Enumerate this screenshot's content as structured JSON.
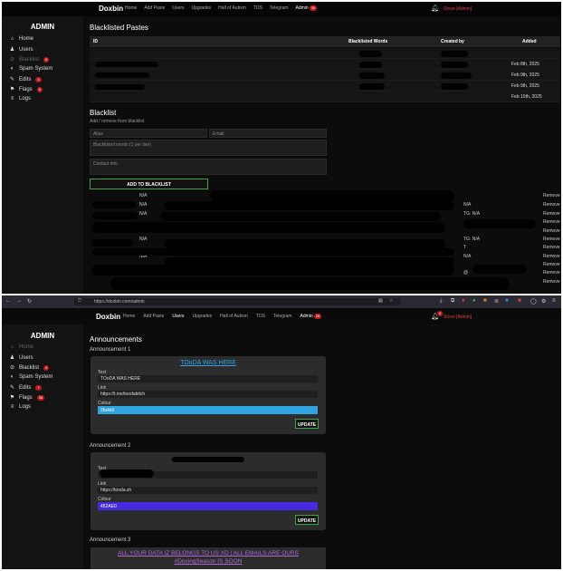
{
  "top": {
    "brand": "Doxbin",
    "nav": [
      "Home",
      "Add Paste",
      "Users",
      "Upgrades",
      "Hall of Autism",
      "TOS",
      "Telegram"
    ],
    "nav_admin": "Admin",
    "nav_admin_badge": "26",
    "user": "Stove [Admin]",
    "sidebar_title": "ADMIN",
    "sidebar": [
      {
        "label": "Home",
        "icon": "home-icon",
        "glyph": "⌂",
        "badge": ""
      },
      {
        "label": "Users",
        "icon": "user-icon",
        "glyph": "♟",
        "badge": ""
      },
      {
        "label": "Blacklist",
        "icon": "ban-icon",
        "glyph": "⊘",
        "badge": "6"
      },
      {
        "label": "Spam System",
        "icon": "toggle-icon",
        "glyph": "◐",
        "badge": ""
      },
      {
        "label": "Edits",
        "icon": "pencil-icon",
        "glyph": "✎",
        "badge": "4"
      },
      {
        "label": "Flags",
        "icon": "flag-icon",
        "glyph": "⚑",
        "badge": "6"
      },
      {
        "label": "Logs",
        "icon": "list-icon",
        "glyph": "≡",
        "badge": ""
      }
    ],
    "page_title": "Blacklisted Pastes",
    "table_headers": [
      "ID",
      "Blacklisted Words",
      "Created by",
      "Added"
    ],
    "rows_added": [
      "",
      "Feb 8th, 2025",
      "Feb 9th, 2025",
      "Feb 9th, 2025",
      "Feb 10th, 2025"
    ],
    "blacklist_title": "Blacklist",
    "blacklist_subtitle": "Add / remove from blacklist",
    "alias_placeholder": "Alias",
    "email_placeholder": "Email",
    "words_placeholder": "Blacklisted words (1 per line)",
    "contact_placeholder": "Contact info",
    "add_button": "ADD TO BLACKLIST",
    "bl_left": [
      "N/A",
      "N/A",
      "N/A",
      "",
      "",
      "N/A",
      "",
      "N/A",
      "",
      "",
      ""
    ],
    "bl_right": [
      "",
      "N/A",
      "TG: N/A",
      "",
      "",
      "TG: N/A",
      "T",
      "N/A",
      "",
      "@",
      ""
    ],
    "remove_label": "Remove"
  },
  "bottom": {
    "url": "https://doxbin.com/admin",
    "brand": "Doxbin",
    "nav": [
      "Home",
      "Add Paste",
      "Users",
      "Upgrades",
      "Hall of Autism",
      "TOS",
      "Telegram"
    ],
    "nav_admin": "Admin",
    "nav_admin_badge": "26",
    "bell_badge": "3",
    "user": "Stove [Admin]",
    "sidebar_title": "ADMIN",
    "sidebar": [
      {
        "label": "Home",
        "icon": "home-icon",
        "glyph": "⌂",
        "badge": ""
      },
      {
        "label": "Users",
        "icon": "user-icon",
        "glyph": "♟",
        "badge": ""
      },
      {
        "label": "Blacklist",
        "icon": "ban-icon",
        "glyph": "⊘",
        "badge": "4"
      },
      {
        "label": "Spam System",
        "icon": "toggle-icon",
        "glyph": "◐",
        "badge": ""
      },
      {
        "label": "Edits",
        "icon": "pencil-icon",
        "glyph": "✎",
        "badge": "7"
      },
      {
        "label": "Flags",
        "icon": "flag-icon",
        "glyph": "⚑",
        "badge": "38"
      },
      {
        "label": "Logs",
        "icon": "list-icon",
        "glyph": "≡",
        "badge": ""
      }
    ],
    "page_title": "Announcements",
    "a1": {
      "title": "Announcement 1",
      "heading": "TOoDA WAS HERE",
      "heading_color": "#2aa6e8",
      "text_label": "Text",
      "text_value": "TOoDA WAS HERE",
      "link_label": "Link",
      "link_value": "https://t.me/toodabitch",
      "colour_label": "Colour",
      "colour_value": "2fa4e0",
      "colour_swatch": "#2fa4e0",
      "update": "UPDATE"
    },
    "a2": {
      "title": "Announcement 2",
      "text_label": "Text",
      "link_label": "Link",
      "link_value": "https://tooda.sh",
      "colour_label": "Colour",
      "colour_value": "452AE0",
      "colour_swatch": "#452ae0",
      "update": "UPDATE"
    },
    "a3": {
      "title": "Announcement 3",
      "line1": "ALL YOUR DATA IZ BELONGS TO US XD | ALL EMAILS ARE OURS",
      "line2": "#DoxingSeason IS SOON"
    }
  }
}
